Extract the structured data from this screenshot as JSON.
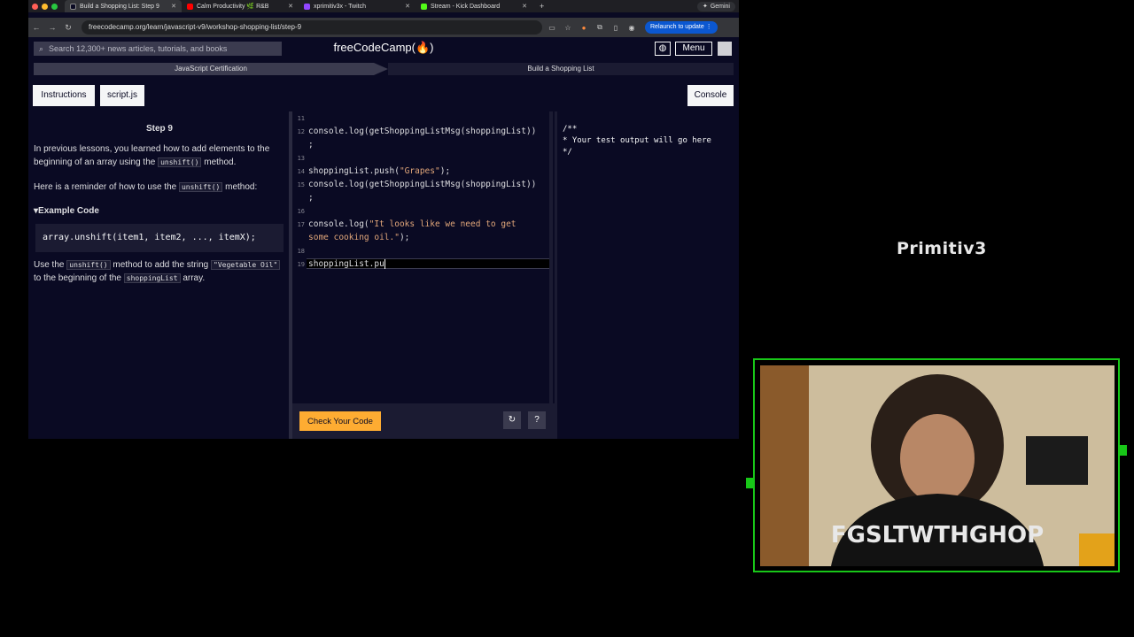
{
  "browser": {
    "tabs": [
      {
        "title": "Build a Shopping List: Step 9",
        "active": true,
        "favicon_color": "#0a0a23"
      },
      {
        "title": "Calm Productivity 🌿 R&B",
        "active": false,
        "favicon_color": "#ff0000"
      },
      {
        "title": "xprimitiv3x - Twitch",
        "active": false,
        "favicon_color": "#9146ff"
      },
      {
        "title": "Stream - Kick Dashboard",
        "active": false,
        "favicon_color": "#53fc18"
      }
    ],
    "new_tab": "+",
    "gemini_label": "Gemini",
    "url": "freecodecamp.org/learn/javascript-v9/workshop-shopping-list/step-9",
    "relaunch_label": "Relaunch to update"
  },
  "fcc": {
    "search_placeholder": "Search 12,300+ news articles, tutorials, and books",
    "logo": "freeCodeCamp(🔥)",
    "menu_label": "Menu",
    "breadcrumb": [
      "JavaScript Certification",
      "Build a Shopping List"
    ],
    "tab_instructions": "Instructions",
    "tab_script": "script.js",
    "tab_console": "Console"
  },
  "lesson": {
    "step_title": "Step 9",
    "p1_a": "In previous lessons, you learned how to add elements to the beginning of an array using the ",
    "p1_code": "unshift()",
    "p1_b": " method.",
    "p2_a": "Here is a reminder of how to use the ",
    "p2_code": "unshift()",
    "p2_b": " method:",
    "example_title": "▾Example Code",
    "example_code": "array.unshift(item1, item2, ..., itemX);",
    "p3_a": "Use the ",
    "p3_code1": "unshift()",
    "p3_b": " method to add the string ",
    "p3_code2": "\"Vegetable Oil\"",
    "p3_c": " to the beginning of the ",
    "p3_code3": "shoppingList",
    "p3_d": " array."
  },
  "editor": {
    "lines": {
      "l11": "11",
      "l12": "12",
      "l13": "13",
      "l14": "14",
      "l15": "15",
      "l16": "16",
      "l17": "17",
      "l18": "18",
      "l19": "19"
    },
    "code12a": "console.log(getShoppingListMsg(shoppingList))",
    "code12b": ";",
    "code14a": "shoppingList.push(",
    "code14s": "\"Grapes\"",
    "code14b": ");",
    "code15a": "console.log(getShoppingListMsg(shoppingList))",
    "code15b": ";",
    "code17a": "console.log(",
    "code17s1": "\"It looks like we need to get",
    "code17s2": "some cooking oil.\"",
    "code17b": ");",
    "code19": "shoppingList.pu",
    "check_button": "Check Your Code",
    "reset_icon": "↻",
    "help_icon": "?"
  },
  "console_output": "/**\n* Your test output will go here\n*/",
  "stream": {
    "brand": "Primitiv3",
    "accent": "#18c718"
  }
}
